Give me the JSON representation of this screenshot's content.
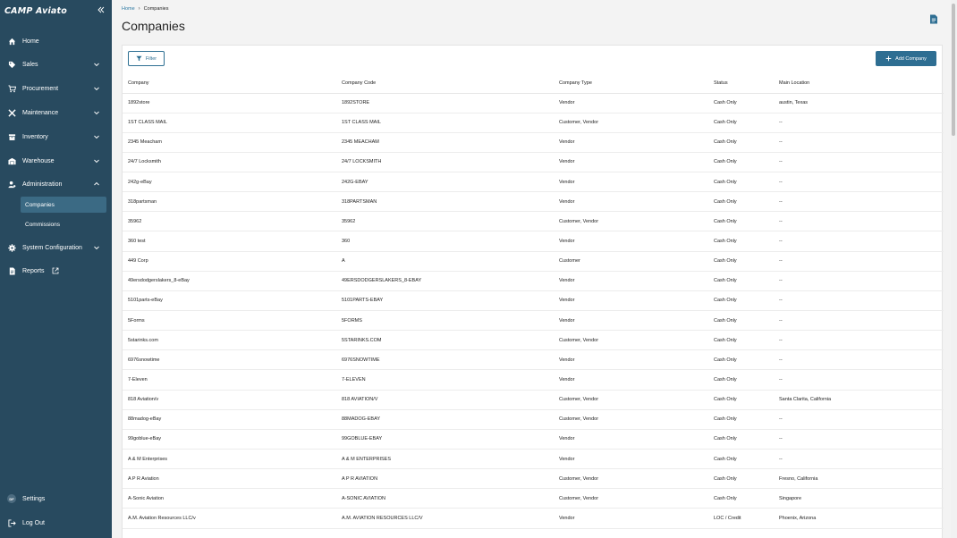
{
  "app": {
    "logo_text": "CAMP Aviato"
  },
  "sidebar": {
    "items": [
      {
        "label": "Home",
        "icon": "home-icon"
      },
      {
        "label": "Sales",
        "icon": "tag-icon"
      },
      {
        "label": "Procurement",
        "icon": "cart-icon"
      },
      {
        "label": "Maintenance",
        "icon": "wrench-icon"
      },
      {
        "label": "Inventory",
        "icon": "inventory-icon"
      },
      {
        "label": "Warehouse",
        "icon": "warehouse-icon"
      },
      {
        "label": "Administration",
        "icon": "admin-icon"
      },
      {
        "label": "System Configuration",
        "icon": "gear-icon"
      },
      {
        "label": "Reports",
        "icon": "report-icon"
      }
    ],
    "sub_items": [
      {
        "label": "Companies"
      },
      {
        "label": "Commissions"
      }
    ],
    "settings_label": "Settings",
    "avatar_initials": "DF",
    "logout_label": "Log Out"
  },
  "breadcrumb": {
    "home": "Home",
    "current": "Companies"
  },
  "page": {
    "title": "Companies"
  },
  "toolbar": {
    "filter_label": "Filter",
    "add_label": "Add Company"
  },
  "table": {
    "headers": [
      "Company",
      "Company Code",
      "Company Type",
      "Status",
      "Main Location"
    ],
    "rows": [
      [
        "1892store",
        "1892STORE",
        "Vendor",
        "Cash Only",
        "austin, Texas"
      ],
      [
        "1ST CLASS MAIL",
        "1ST CLASS MAIL",
        "Customer, Vendor",
        "Cash Only",
        "--"
      ],
      [
        "2345 Meacham",
        "2345 MEACHAM",
        "Vendor",
        "Cash Only",
        "--"
      ],
      [
        "24/7 Locksmith",
        "24/7 LOCKSMITH",
        "Vendor",
        "Cash Only",
        "--"
      ],
      [
        "242g-eBay",
        "242G-EBAY",
        "Vendor",
        "Cash Only",
        "--"
      ],
      [
        "318partsman",
        "318PARTSMAN",
        "Vendor",
        "Cash Only",
        "--"
      ],
      [
        "35962",
        "35962",
        "Customer, Vendor",
        "Cash Only",
        "--"
      ],
      [
        "360 test",
        "360",
        "Vendor",
        "Cash Only",
        "--"
      ],
      [
        "449 Corp",
        "A",
        "Customer",
        "Cash Only",
        "--"
      ],
      [
        "49ersdodgerslakers_8-eBay",
        "49ERSDODGERSLAKERS_8-EBAY",
        "Vendor",
        "Cash Only",
        "--"
      ],
      [
        "5101parts-eBay",
        "5101PARTS-EBAY",
        "Vendor",
        "Cash Only",
        "--"
      ],
      [
        "5Forms",
        "5FORMS",
        "Vendor",
        "Cash Only",
        "--"
      ],
      [
        "5starinks.com",
        "5STARINKS.COM",
        "Customer, Vendor",
        "Cash Only",
        "--"
      ],
      [
        "6976snowtime",
        "6976SNOWTIME",
        "Vendor",
        "Cash Only",
        "--"
      ],
      [
        "7-Eleven",
        "7-ELEVEN",
        "Vendor",
        "Cash Only",
        "--"
      ],
      [
        "818 Aviation/v",
        "818 AVIATION/V",
        "Customer, Vendor",
        "Cash Only",
        "Santa Clarita, California"
      ],
      [
        "88madog-eBay",
        "88MADOG-EBAY",
        "Customer, Vendor",
        "Cash Only",
        "--"
      ],
      [
        "99goblue-eBay",
        "99GOBLUE-EBAY",
        "Vendor",
        "Cash Only",
        "--"
      ],
      [
        "A & M Enterprises",
        "A & M ENTERPRISES",
        "Vendor",
        "Cash Only",
        "--"
      ],
      [
        "A P R Aviation",
        "A P R AVIATION",
        "Customer, Vendor",
        "Cash Only",
        "Fresno, California"
      ],
      [
        "A-Sonic Aviation",
        "A-SONIC AVIATION",
        "Customer, Vendor",
        "Cash Only",
        "Singapore"
      ],
      [
        "A.M. Aviation Resources LLC/v",
        "A.M. AVIATION RESOURCES LLC/V",
        "Vendor",
        "LOC / Credit",
        "Phoenix, Arizona"
      ],
      [
        "",
        "",
        "",
        "",
        ""
      ]
    ]
  }
}
